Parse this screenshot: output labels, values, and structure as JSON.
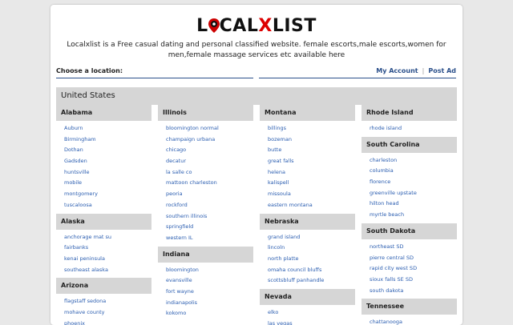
{
  "logo": {
    "left": "L",
    "mid": "CAL",
    "x": "X",
    "right": "LIST"
  },
  "tagline": "Localxlist is a Free casual dating and personal classified website. female escorts,male escorts,women for men,female massage services etc available here",
  "location_label": "Choose a location:",
  "account": {
    "my_account": "My Account",
    "post_ad": "Post Ad"
  },
  "country": "United States",
  "columns": [
    [
      {
        "state": "Alabama",
        "cities": [
          "Auburn",
          "Birmingham",
          "Dothan",
          "Gadsden",
          "huntsville",
          "mobile",
          "montgomery",
          "tuscaloosa"
        ]
      },
      {
        "state": "Alaska",
        "cities": [
          "anchorage mat su",
          "fairbanks",
          "kenai peninsula",
          "southeast alaska"
        ]
      },
      {
        "state": "Arizona",
        "cities": [
          "flagstaff sedona",
          "mohave county",
          "phoenix"
        ]
      }
    ],
    [
      {
        "state": "Illinois",
        "cities": [
          "bloomington normal",
          "champaign urbana",
          "chicago",
          "decatur",
          "la salle co",
          "mattoon charleston",
          "peoria",
          "rockford",
          "southern illinois",
          "springfield",
          "western IL"
        ]
      },
      {
        "state": "Indiana",
        "cities": [
          "bloomington",
          "evansville",
          "fort wayne",
          "indianapolis",
          "kokomo"
        ]
      }
    ],
    [
      {
        "state": "Montana",
        "cities": [
          "billings",
          "bozeman",
          "butte",
          "great falls",
          "helena",
          "kalispell",
          "missoula",
          "eastern montana"
        ]
      },
      {
        "state": "Nebraska",
        "cities": [
          "grand island",
          "lincoln",
          "north platte",
          "omaha council bluffs",
          "scottsbluff panhandle"
        ]
      },
      {
        "state": "Nevada",
        "cities": [
          "elko",
          "las vegas"
        ]
      }
    ],
    [
      {
        "state": "Rhode Island",
        "cities": [
          "rhode island"
        ]
      },
      {
        "state": "South Carolina",
        "cities": [
          "charleston",
          "columbia",
          "florence",
          "greenville upstate",
          "hilton head",
          "myrtle beach"
        ]
      },
      {
        "state": "South Dakota",
        "cities": [
          "northeast SD",
          "pierre central SD",
          "rapid city west SD",
          "sioux falls SE SD",
          "south dakota"
        ]
      },
      {
        "state": "Tennessee",
        "cities": [
          "chattanooga"
        ]
      }
    ]
  ]
}
